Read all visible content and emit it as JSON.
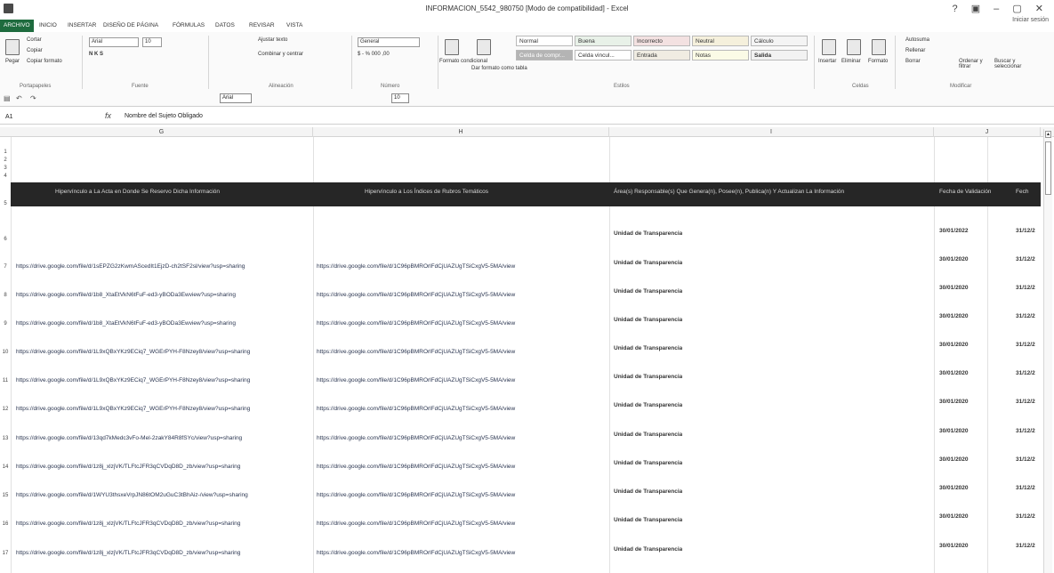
{
  "window": {
    "title": "INFORMACION_5542_980750 [Modo de compatibilidad] - Excel",
    "controls": "? ▣ – ▢ ✕",
    "sign_in": "Iniciar sesión"
  },
  "tabs": [
    "ARCHIVO",
    "INICIO",
    "INSERTAR",
    "DISEÑO DE PÁGINA",
    "FÓRMULAS",
    "DATOS",
    "REVISAR",
    "VISTA"
  ],
  "ribbon": {
    "clipboard": {
      "paste": "Pegar",
      "cut": "Cortar",
      "copy": "Copiar",
      "format_painter": "Copiar formato",
      "label": "Portapapeles"
    },
    "font": {
      "name": "Arial",
      "size": "10",
      "label": "Fuente"
    },
    "alignment": {
      "wrap": "Ajustar texto",
      "merge": "Combinar y centrar",
      "label": "Alineación"
    },
    "number": {
      "format": "General",
      "label": "Número"
    },
    "styles": {
      "conditional": "Formato condicional",
      "as_table": "Dar formato como tabla",
      "label": "Estilos",
      "cells": [
        "Normal",
        "Buena",
        "Incorrecto",
        "Neutral",
        "Cálculo",
        "Celda de compr...",
        "Celda vincul...",
        "Entrada",
        "Notas",
        "Salida"
      ]
    },
    "cells_group": {
      "insert": "Insertar",
      "delete": "Eliminar",
      "format": "Formato",
      "label": "Celdas"
    },
    "editing": {
      "autosum": "Autosuma",
      "fill": "Rellenar",
      "clear": "Borrar",
      "sort": "Ordenar y filtrar",
      "find": "Buscar y seleccionar",
      "label": "Modificar"
    }
  },
  "qat": {
    "font": "Arial",
    "size": "10"
  },
  "formula_bar": {
    "name_box": "A1",
    "fx": "fx",
    "content": "Nombre del Sujeto Obligado"
  },
  "columns": [
    "G",
    "H",
    "I",
    "J"
  ],
  "header_row": {
    "g": "Hipervínculo a La Acta en Donde Se Reservo Dicha Información",
    "h": "Hipervínculo a Los Índices de Rubros Temáticos",
    "i": "Área(s) Responsable(s) Que Genera(n), Posee(n), Publica(n) Y Actualizan La Información",
    "j": "Fecha de Validación",
    "k": "Fech"
  },
  "rows": [
    {
      "num": "6",
      "g": "",
      "h": "",
      "i": "Unidad de Transparencia",
      "j": "30/01/2022",
      "k": "31/12/2"
    },
    {
      "num": "7",
      "g": "https://drive.google.com/file/d/1sEPZG2zKwmAScedIt1EjzD-ch2tSF2sl/view?usp=sharing",
      "h": "https://drive.google.com/file/d/1C96pBMROrlFdCjUAZUgTSiCxgV5-5MA/view",
      "i": "Unidad de Transparencia",
      "j": "30/01/2020",
      "k": "31/12/2"
    },
    {
      "num": "8",
      "g": "https://drive.google.com/file/d/1b8_XtaEtVkN6tFuF-ed3-yBODa3Ewview?usp=sharing",
      "h": "https://drive.google.com/file/d/1C96pBMROrlFdCjUAZUgTSiCxgV5-5MA/view",
      "i": "Unidad de Transparencia",
      "j": "30/01/2020",
      "k": "31/12/2"
    },
    {
      "num": "9",
      "g": "https://drive.google.com/file/d/1b8_XtaEtVkN6tFuF-ed3-yBODa3Ewview?usp=sharing",
      "h": "https://drive.google.com/file/d/1C96pBMROrlFdCjUAZUgTSiCxgV5-5MA/view",
      "i": "Unidad de Transparencia",
      "j": "30/01/2020",
      "k": "31/12/2"
    },
    {
      "num": "10",
      "g": "https://drive.google.com/file/d/1L9xQBxYKz9ECiq7_WGErPYH-F8Nzey8/view?usp=sharing",
      "h": "https://drive.google.com/file/d/1C96pBMROrlFdCjUAZUgTSiCxgV5-5MA/view",
      "i": "Unidad de Transparencia",
      "j": "30/01/2020",
      "k": "31/12/2"
    },
    {
      "num": "11",
      "g": "https://drive.google.com/file/d/1L9xQBxYKz9ECiq7_WGErPYH-F8Nzey8/view?usp=sharing",
      "h": "https://drive.google.com/file/d/1C96pBMROrlFdCjUAZUgTSiCxgV5-5MA/view",
      "i": "Unidad de Transparencia",
      "j": "30/01/2020",
      "k": "31/12/2"
    },
    {
      "num": "12",
      "g": "https://drive.google.com/file/d/1L9xQBxYKz9ECiq7_WGErPYH-F8Nzey8/view?usp=sharing",
      "h": "https://drive.google.com/file/d/1C96pBMROrlFdCjUAZUgTSiCxgV5-5MA/view",
      "i": "Unidad de Transparencia",
      "j": "30/01/2020",
      "k": "31/12/2"
    },
    {
      "num": "13",
      "g": "https://drive.google.com/file/d/13qd7kMedc3vFo-Mel-2zakY84R8fSYc/view?usp=sharing",
      "h": "https://drive.google.com/file/d/1C96pBMROrlFdCjUAZUgTSiCxgV5-5MA/view",
      "i": "Unidad de Transparencia",
      "j": "30/01/2020",
      "k": "31/12/2"
    },
    {
      "num": "14",
      "g": "https://drive.google.com/file/d/1z8j_xlzjVK/TLFtcJFR3qCVDqD8D_zb/view?usp=sharing",
      "h": "https://drive.google.com/file/d/1C96pBMROrlFdCjUAZUgTSiCxgV5-5MA/view",
      "i": "Unidad de Transparencia",
      "j": "30/01/2020",
      "k": "31/12/2"
    },
    {
      "num": "15",
      "g": "https://drive.google.com/file/d/1WYU3thsxeVrpJN86tOM2uGuC3tBhAiz-/view?usp=sharing",
      "h": "https://drive.google.com/file/d/1C96pBMROrlFdCjUAZUgTSiCxgV5-5MA/view",
      "i": "Unidad de Transparencia",
      "j": "30/01/2020",
      "k": "31/12/2"
    },
    {
      "num": "16",
      "g": "https://drive.google.com/file/d/1z8j_xlzjVK/TLFtcJFR3qCVDqD8D_zb/view?usp=sharing",
      "h": "https://drive.google.com/file/d/1C96pBMROrlFdCjUAZUgTSiCxgV5-5MA/view",
      "i": "Unidad de Transparencia",
      "j": "30/01/2020",
      "k": "31/12/2"
    },
    {
      "num": "17",
      "g": "https://drive.google.com/file/d/1z8j_xlzjVK/TLFtcJFR3qCVDqD8D_zb/view?usp=sharing",
      "h": "https://drive.google.com/file/d/1C96pBMROrlFdCjUAZUgTSiCxgV5-5MA/view",
      "i": "Unidad de Transparencia",
      "j": "30/01/2020",
      "k": "31/12/2"
    }
  ],
  "colors": {
    "accent": "#1e6b3e",
    "header_band": "#262626"
  }
}
